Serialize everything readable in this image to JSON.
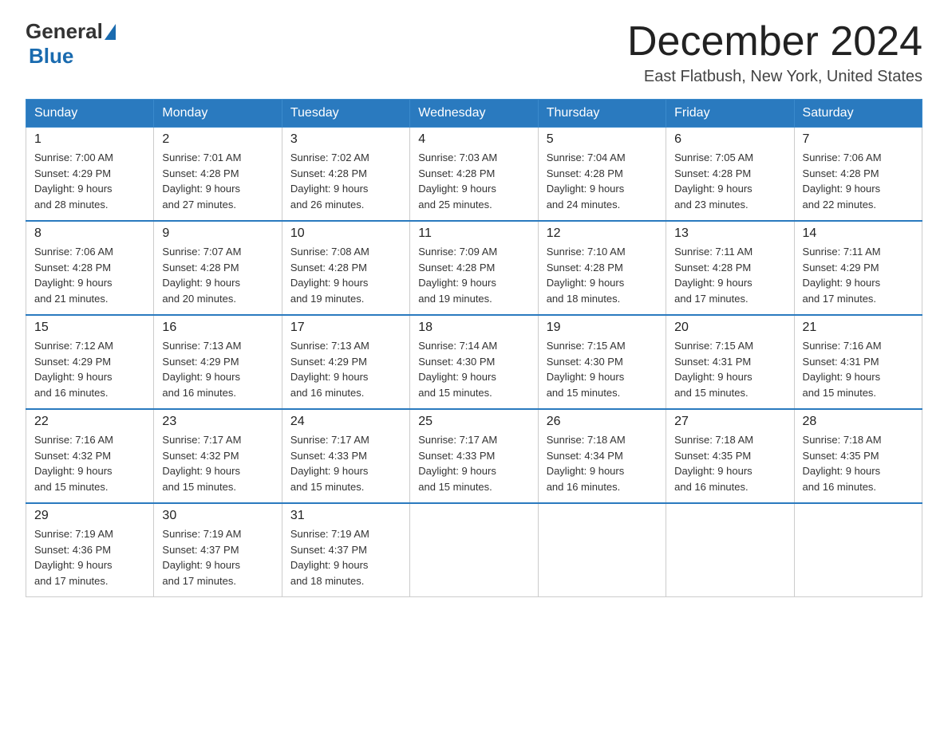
{
  "header": {
    "logo_general": "General",
    "logo_blue": "Blue",
    "month_title": "December 2024",
    "location": "East Flatbush, New York, United States"
  },
  "weekdays": [
    "Sunday",
    "Monday",
    "Tuesday",
    "Wednesday",
    "Thursday",
    "Friday",
    "Saturday"
  ],
  "weeks": [
    [
      {
        "day": "1",
        "sunrise": "7:00 AM",
        "sunset": "4:29 PM",
        "daylight": "9 hours and 28 minutes."
      },
      {
        "day": "2",
        "sunrise": "7:01 AM",
        "sunset": "4:28 PM",
        "daylight": "9 hours and 27 minutes."
      },
      {
        "day": "3",
        "sunrise": "7:02 AM",
        "sunset": "4:28 PM",
        "daylight": "9 hours and 26 minutes."
      },
      {
        "day": "4",
        "sunrise": "7:03 AM",
        "sunset": "4:28 PM",
        "daylight": "9 hours and 25 minutes."
      },
      {
        "day": "5",
        "sunrise": "7:04 AM",
        "sunset": "4:28 PM",
        "daylight": "9 hours and 24 minutes."
      },
      {
        "day": "6",
        "sunrise": "7:05 AM",
        "sunset": "4:28 PM",
        "daylight": "9 hours and 23 minutes."
      },
      {
        "day": "7",
        "sunrise": "7:06 AM",
        "sunset": "4:28 PM",
        "daylight": "9 hours and 22 minutes."
      }
    ],
    [
      {
        "day": "8",
        "sunrise": "7:06 AM",
        "sunset": "4:28 PM",
        "daylight": "9 hours and 21 minutes."
      },
      {
        "day": "9",
        "sunrise": "7:07 AM",
        "sunset": "4:28 PM",
        "daylight": "9 hours and 20 minutes."
      },
      {
        "day": "10",
        "sunrise": "7:08 AM",
        "sunset": "4:28 PM",
        "daylight": "9 hours and 19 minutes."
      },
      {
        "day": "11",
        "sunrise": "7:09 AM",
        "sunset": "4:28 PM",
        "daylight": "9 hours and 19 minutes."
      },
      {
        "day": "12",
        "sunrise": "7:10 AM",
        "sunset": "4:28 PM",
        "daylight": "9 hours and 18 minutes."
      },
      {
        "day": "13",
        "sunrise": "7:11 AM",
        "sunset": "4:28 PM",
        "daylight": "9 hours and 17 minutes."
      },
      {
        "day": "14",
        "sunrise": "7:11 AM",
        "sunset": "4:29 PM",
        "daylight": "9 hours and 17 minutes."
      }
    ],
    [
      {
        "day": "15",
        "sunrise": "7:12 AM",
        "sunset": "4:29 PM",
        "daylight": "9 hours and 16 minutes."
      },
      {
        "day": "16",
        "sunrise": "7:13 AM",
        "sunset": "4:29 PM",
        "daylight": "9 hours and 16 minutes."
      },
      {
        "day": "17",
        "sunrise": "7:13 AM",
        "sunset": "4:29 PM",
        "daylight": "9 hours and 16 minutes."
      },
      {
        "day": "18",
        "sunrise": "7:14 AM",
        "sunset": "4:30 PM",
        "daylight": "9 hours and 15 minutes."
      },
      {
        "day": "19",
        "sunrise": "7:15 AM",
        "sunset": "4:30 PM",
        "daylight": "9 hours and 15 minutes."
      },
      {
        "day": "20",
        "sunrise": "7:15 AM",
        "sunset": "4:31 PM",
        "daylight": "9 hours and 15 minutes."
      },
      {
        "day": "21",
        "sunrise": "7:16 AM",
        "sunset": "4:31 PM",
        "daylight": "9 hours and 15 minutes."
      }
    ],
    [
      {
        "day": "22",
        "sunrise": "7:16 AM",
        "sunset": "4:32 PM",
        "daylight": "9 hours and 15 minutes."
      },
      {
        "day": "23",
        "sunrise": "7:17 AM",
        "sunset": "4:32 PM",
        "daylight": "9 hours and 15 minutes."
      },
      {
        "day": "24",
        "sunrise": "7:17 AM",
        "sunset": "4:33 PM",
        "daylight": "9 hours and 15 minutes."
      },
      {
        "day": "25",
        "sunrise": "7:17 AM",
        "sunset": "4:33 PM",
        "daylight": "9 hours and 15 minutes."
      },
      {
        "day": "26",
        "sunrise": "7:18 AM",
        "sunset": "4:34 PM",
        "daylight": "9 hours and 16 minutes."
      },
      {
        "day": "27",
        "sunrise": "7:18 AM",
        "sunset": "4:35 PM",
        "daylight": "9 hours and 16 minutes."
      },
      {
        "day": "28",
        "sunrise": "7:18 AM",
        "sunset": "4:35 PM",
        "daylight": "9 hours and 16 minutes."
      }
    ],
    [
      {
        "day": "29",
        "sunrise": "7:19 AM",
        "sunset": "4:36 PM",
        "daylight": "9 hours and 17 minutes."
      },
      {
        "day": "30",
        "sunrise": "7:19 AM",
        "sunset": "4:37 PM",
        "daylight": "9 hours and 17 minutes."
      },
      {
        "day": "31",
        "sunrise": "7:19 AM",
        "sunset": "4:37 PM",
        "daylight": "9 hours and 18 minutes."
      },
      null,
      null,
      null,
      null
    ]
  ],
  "labels": {
    "sunrise": "Sunrise:",
    "sunset": "Sunset:",
    "daylight": "Daylight:"
  }
}
